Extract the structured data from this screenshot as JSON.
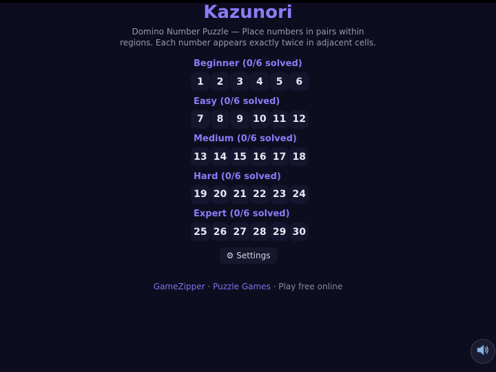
{
  "header": {
    "title": "Kazunori",
    "subtitle": "Domino Number Puzzle — Place numbers in pairs within regions. Each number appears exactly twice in adjacent cells."
  },
  "levels": [
    {
      "heading": "Beginner (0/6 solved)",
      "puzzles": [
        "1",
        "2",
        "3",
        "4",
        "5",
        "6"
      ]
    },
    {
      "heading": "Easy (0/6 solved)",
      "puzzles": [
        "7",
        "8",
        "9",
        "10",
        "11",
        "12"
      ]
    },
    {
      "heading": "Medium (0/6 solved)",
      "puzzles": [
        "13",
        "14",
        "15",
        "16",
        "17",
        "18"
      ]
    },
    {
      "heading": "Hard (0/6 solved)",
      "puzzles": [
        "19",
        "20",
        "21",
        "22",
        "23",
        "24"
      ]
    },
    {
      "heading": "Expert (0/6 solved)",
      "puzzles": [
        "25",
        "26",
        "27",
        "28",
        "29",
        "30"
      ]
    }
  ],
  "settings": {
    "icon": "gear-icon",
    "icon_glyph": "⚙",
    "label": "Settings"
  },
  "footer": {
    "site_link": "GameZipper",
    "separator": " · ",
    "category_link": "Puzzle Games",
    "tagline": "Play free online"
  },
  "sound": {
    "icon": "speaker-icon"
  },
  "colors": {
    "background": "#0d0d1f",
    "accent": "#8b7cf6",
    "button_bg": "#15152e"
  }
}
